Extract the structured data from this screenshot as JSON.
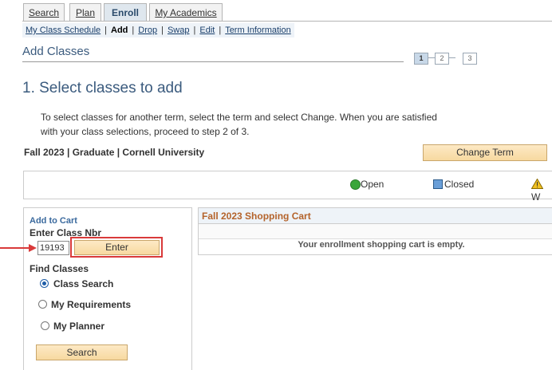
{
  "tabs": [
    {
      "label": "Search"
    },
    {
      "label": "Plan"
    },
    {
      "label": "Enroll"
    },
    {
      "label": "My Academics"
    }
  ],
  "subnav": {
    "my_class_schedule": "My Class Schedule",
    "add": "Add",
    "drop": "Drop",
    "swap": "Swap",
    "edit": "Edit",
    "term_information": "Term Information",
    "separator": "|"
  },
  "page_title": "Add Classes",
  "steps": [
    "1",
    "2",
    "3"
  ],
  "section_title": "1.  Select classes to add",
  "instructions_line1": "To select classes for another term, select the term and select Change.  When you are satisfied",
  "instructions_line2": "with your class selections, proceed to step 2 of 3.",
  "term_info": "Fall 2023 | Graduate | Cornell University",
  "change_term_label": "Change Term",
  "legend": {
    "open": "Open",
    "closed": "Closed",
    "wait": "W"
  },
  "add_to_cart": {
    "heading": "Add to Cart",
    "enter_class_nbr": "Enter Class Nbr",
    "class_nbr_value": "19193",
    "enter_button": "Enter"
  },
  "find_classes": {
    "heading": "Find Classes",
    "options": [
      {
        "label": "Class Search",
        "selected": true
      },
      {
        "label": "My Requirements",
        "selected": false
      },
      {
        "label": "My Planner",
        "selected": false
      }
    ],
    "search_button": "Search"
  },
  "cart": {
    "title": "Fall 2023 Shopping Cart",
    "empty_message": "Your enrollment shopping cart is empty."
  },
  "colors": {
    "accent": "#3b5b7e",
    "cart_title": "#b4632b",
    "highlight": "#d93a3a",
    "open": "#3aa63a",
    "closed": "#6a9fd8",
    "wait": "#f0c020"
  }
}
